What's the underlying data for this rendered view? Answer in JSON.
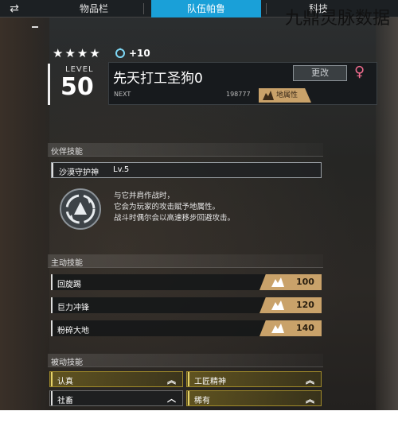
{
  "topbar": {
    "tabs": [
      {
        "label": "物品栏"
      },
      {
        "label": "队伍帕鲁"
      },
      {
        "label": "科技"
      }
    ]
  },
  "header": {
    "stars": "★★★★",
    "bonus": "+10",
    "level_label": "LEVEL",
    "level": "50",
    "name": "先天打工圣狗0",
    "rename_label": "更改",
    "gender_symbol": "♀",
    "next_label": "NEXT",
    "next_exp": "198777",
    "element": "地属性"
  },
  "partner_skill": {
    "section_title": "伙伴技能",
    "name": "沙漠守护神",
    "level": "Lv.5",
    "description": [
      "与它并肩作战时，",
      "它会为玩家的攻击赋予地属性。",
      "战斗时偶尔会以高速移步回避攻击。"
    ]
  },
  "active_skills": {
    "section_title": "主动技能",
    "items": [
      {
        "name": "回旋踢",
        "power": "100"
      },
      {
        "name": "巨力冲锋",
        "power": "120"
      },
      {
        "name": "粉碎大地",
        "power": "140"
      }
    ]
  },
  "passive_skills": {
    "section_title": "被动技能",
    "items": [
      {
        "name": "认真",
        "rank": "︽"
      },
      {
        "name": "工匠精神",
        "rank": "︽"
      },
      {
        "name": "社畜",
        "rank": "︿"
      },
      {
        "name": "稀有",
        "rank": "︽"
      }
    ]
  },
  "watermark": {
    "text": "九鼎灵脉数据"
  },
  "colors": {
    "accent_blue": "#1aa0d8",
    "ground_element": "#c9a26a",
    "passive_gold": "#a08a2a",
    "female_pink": "#f06c8e"
  },
  "icons": {
    "back": "swap-arrows-icon",
    "bonus": "soul-orb-icon",
    "element": "ground-element-icon",
    "partner": "shield-swirl-icon"
  }
}
